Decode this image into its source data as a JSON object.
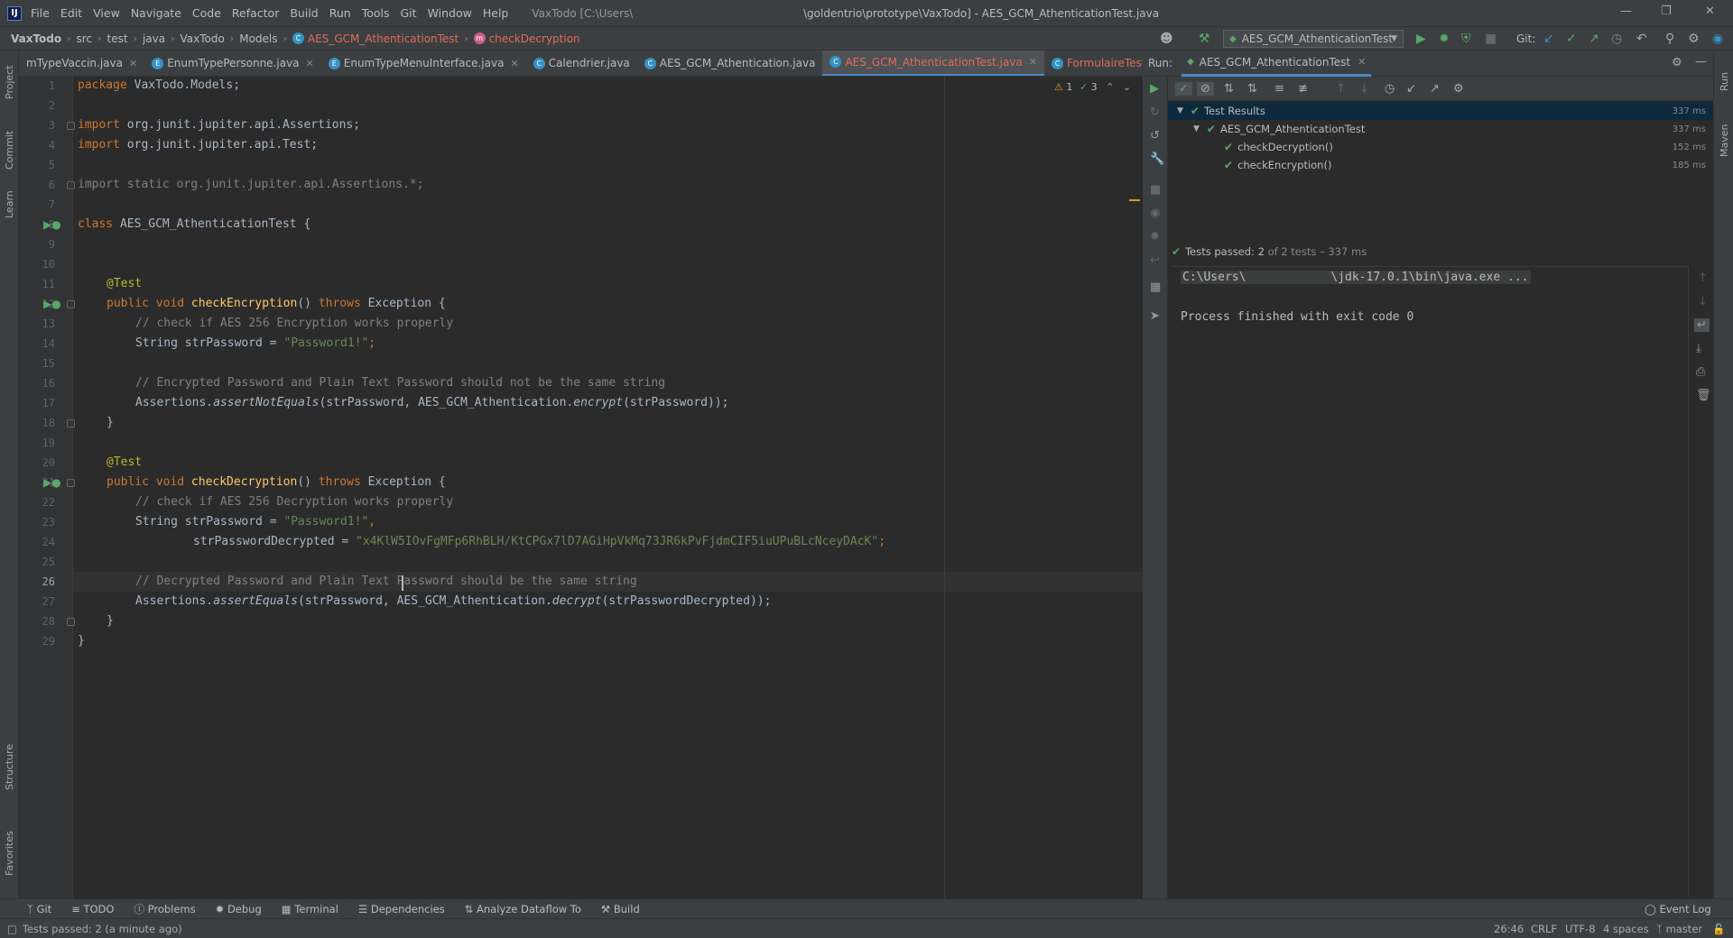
{
  "menu": {
    "items": [
      "File",
      "Edit",
      "View",
      "Navigate",
      "Code",
      "Refactor",
      "Build",
      "Run",
      "Tools",
      "Git",
      "Window",
      "Help"
    ],
    "project_path": "VaxTodo [C:\\Users\\",
    "window_title": "\\goldentrio\\prototype\\VaxTodo] - AES_GCM_AthenticationTest.java"
  },
  "breadcrumb": [
    "VaxTodo",
    "src",
    "test",
    "java",
    "VaxTodo",
    "Models",
    "AES_GCM_AthenticationTest",
    "checkDecryption"
  ],
  "run_config": "AES_GCM_AthenticationTest",
  "git_label": "Git:",
  "tabs": [
    {
      "label": "mTypeVaccin.java",
      "icon": "E"
    },
    {
      "label": "EnumTypePersonne.java",
      "icon": "E"
    },
    {
      "label": "EnumTypeMenuInterface.java",
      "icon": "E"
    },
    {
      "label": "Calendrier.java",
      "icon": "C"
    },
    {
      "label": "AES_GCM_Athentication.java",
      "icon": "C"
    },
    {
      "label": "AES_GCM_AthenticationTest.java",
      "icon": "C",
      "active": true
    },
    {
      "label": "FormulaireTest.java",
      "icon": "C",
      "red": true
    }
  ],
  "inspection": {
    "warnings": "1",
    "checks": "3"
  },
  "line_numbers": [
    "1",
    "2",
    "3",
    "4",
    "5",
    "6",
    "7",
    "8",
    "9",
    "10",
    "11",
    "12",
    "13",
    "14",
    "15",
    "16",
    "17",
    "18",
    "19",
    "20",
    "21",
    "22",
    "23",
    "24",
    "25",
    "26",
    "27",
    "28",
    "29"
  ],
  "code": {
    "l1": [
      "package ",
      "VaxTodo.Models;"
    ],
    "l3": [
      "import ",
      "org.junit.jupiter.api.Assertions;"
    ],
    "l4": [
      "import ",
      "org.junit.jupiter.api.Test;"
    ],
    "l6": "import static org.junit.jupiter.api.Assertions.*;",
    "l8": [
      "class ",
      "AES_GCM_AthenticationTest {"
    ],
    "l11": "@Test",
    "l12": [
      "public void ",
      "checkEncryption",
      "() ",
      "throws ",
      "Exception {"
    ],
    "l13": "// check if AES 256 Encryption works properly",
    "l14": [
      "String strPassword = ",
      "\"Password1!\"",
      ";"
    ],
    "l16": "// Encrypted Password and Plain Text Password should not be the same string",
    "l17": [
      "Assertions.",
      "assertNotEquals",
      "(strPassword, AES_GCM_Athentication.",
      "encrypt",
      "(strPassword));"
    ],
    "l18": "}",
    "l20": "@Test",
    "l21": [
      "public void ",
      "checkDecryption",
      "() ",
      "throws ",
      "Exception {"
    ],
    "l22": "// check if AES 256 Decryption works properly",
    "l23": [
      "String strPassword = ",
      "\"Password1!\"",
      ","
    ],
    "l24": [
      "strPasswordDecrypted = ",
      "\"x4KlW5IOvFgMFp6RhBLH/KtCPGx7lD7AGiHpVkMq73JR6kPvFjdmCIF5iuUPuBLcNceyDAcK\"",
      ";"
    ],
    "l26": "// Decrypted Password and Plain Text Password should be the same string",
    "l27": [
      "Assertions.",
      "assertEquals",
      "(strPassword, AES_GCM_Athentication.",
      "decrypt",
      "(strPasswordDecrypted));"
    ],
    "l28": "}",
    "l29": "}"
  },
  "run": {
    "label": "Run:",
    "tab": "AES_GCM_AthenticationTest",
    "tree": [
      {
        "label": "Test Results",
        "duration": "337 ms"
      },
      {
        "label": "AES_GCM_AthenticationTest",
        "duration": "337 ms"
      },
      {
        "label": "checkDecryption()",
        "duration": "152 ms"
      },
      {
        "label": "checkEncryption()",
        "duration": "185 ms"
      }
    ],
    "summary_bold": "Tests passed: 2",
    "summary_rest": " of 2 tests – 337 ms",
    "console_cmd": "C:\\Users\\            \\jdk-17.0.1\\bin\\java.exe ...",
    "console_exit": "Process finished with exit code 0"
  },
  "left_strip": [
    "Project",
    "Commit",
    "Learn",
    "Structure",
    "Favorites"
  ],
  "right_strip": [
    "Run",
    "Maven"
  ],
  "bottom_tools": [
    "Git",
    "TODO",
    "Problems",
    "Debug",
    "Terminal",
    "Dependencies",
    "Analyze Dataflow To",
    "Build"
  ],
  "event_log": "Event Log",
  "status": {
    "message": "Tests passed: 2 (a minute ago)",
    "position": "26:46",
    "line_sep": "CRLF",
    "encoding": "UTF-8",
    "indent": "4 spaces",
    "branch": "master"
  }
}
